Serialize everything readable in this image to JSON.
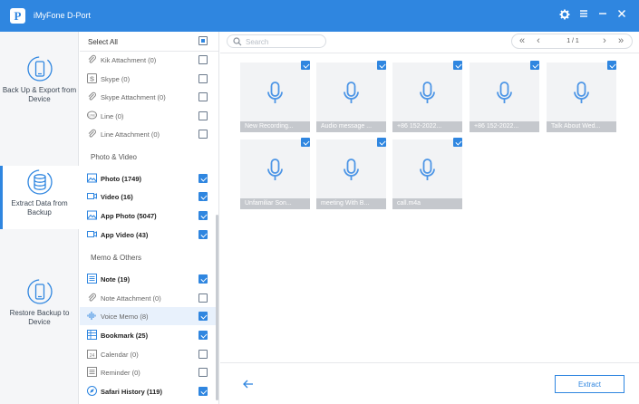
{
  "window": {
    "logo_letter": "P",
    "title": "iMyFone D-Port",
    "icons": [
      "gear-icon",
      "menu-icon",
      "minimize-icon",
      "close-icon"
    ]
  },
  "nav": {
    "items": [
      {
        "label": "Back Up & Export from Device",
        "icon": "phone-backup-icon",
        "active": false
      },
      {
        "label": "Extract Data from Backup",
        "icon": "database-icon",
        "active": true
      },
      {
        "label": "Restore Backup to Device",
        "icon": "phone-restore-icon",
        "active": false
      }
    ]
  },
  "categories": {
    "select_all_label": "Select All",
    "group1": [
      {
        "label": "Kik Attachment (0)",
        "checked": false
      },
      {
        "label": "Skype (0)",
        "checked": false
      },
      {
        "label": "Skype Attachment (0)",
        "checked": false
      },
      {
        "label": "Line (0)",
        "checked": false
      },
      {
        "label": "Line Attachment (0)",
        "checked": false
      }
    ],
    "section_photo": "Photo & Video",
    "photo_video": [
      {
        "label": "Photo (1749)",
        "checked": true
      },
      {
        "label": "Video (16)",
        "checked": true
      },
      {
        "label": "App Photo (5047)",
        "checked": true
      },
      {
        "label": "App Video (43)",
        "checked": true
      }
    ],
    "section_memo": "Memo & Others",
    "memo_others": [
      {
        "label": "Note (19)",
        "checked": true
      },
      {
        "label": "Note Attachment (0)",
        "checked": false
      },
      {
        "label": "Voice Memo (8)",
        "checked": true
      },
      {
        "label": "Bookmark (25)",
        "checked": true
      },
      {
        "label": "Calendar (0)",
        "checked": false
      },
      {
        "label": "Reminder (0)",
        "checked": false
      },
      {
        "label": "Safari History (119)",
        "checked": true
      }
    ]
  },
  "search": {
    "placeholder": "Search",
    "value": ""
  },
  "pager": {
    "text": "1 / 1"
  },
  "tiles": [
    {
      "caption": "New Recording..."
    },
    {
      "caption": "Audio message ..."
    },
    {
      "caption": "+86 152-2022..."
    },
    {
      "caption": "+86 152-2022..."
    },
    {
      "caption": "Talk About Wed..."
    },
    {
      "caption": "Unfamiliar Son..."
    },
    {
      "caption": "meeting With B..."
    },
    {
      "caption": "call.m4a"
    }
  ],
  "footer": {
    "extract_label": "Extract"
  },
  "colors": {
    "accent": "#2f86e0",
    "tile_bg": "#f2f3f5",
    "caption_bg": "#c5c8cd"
  }
}
